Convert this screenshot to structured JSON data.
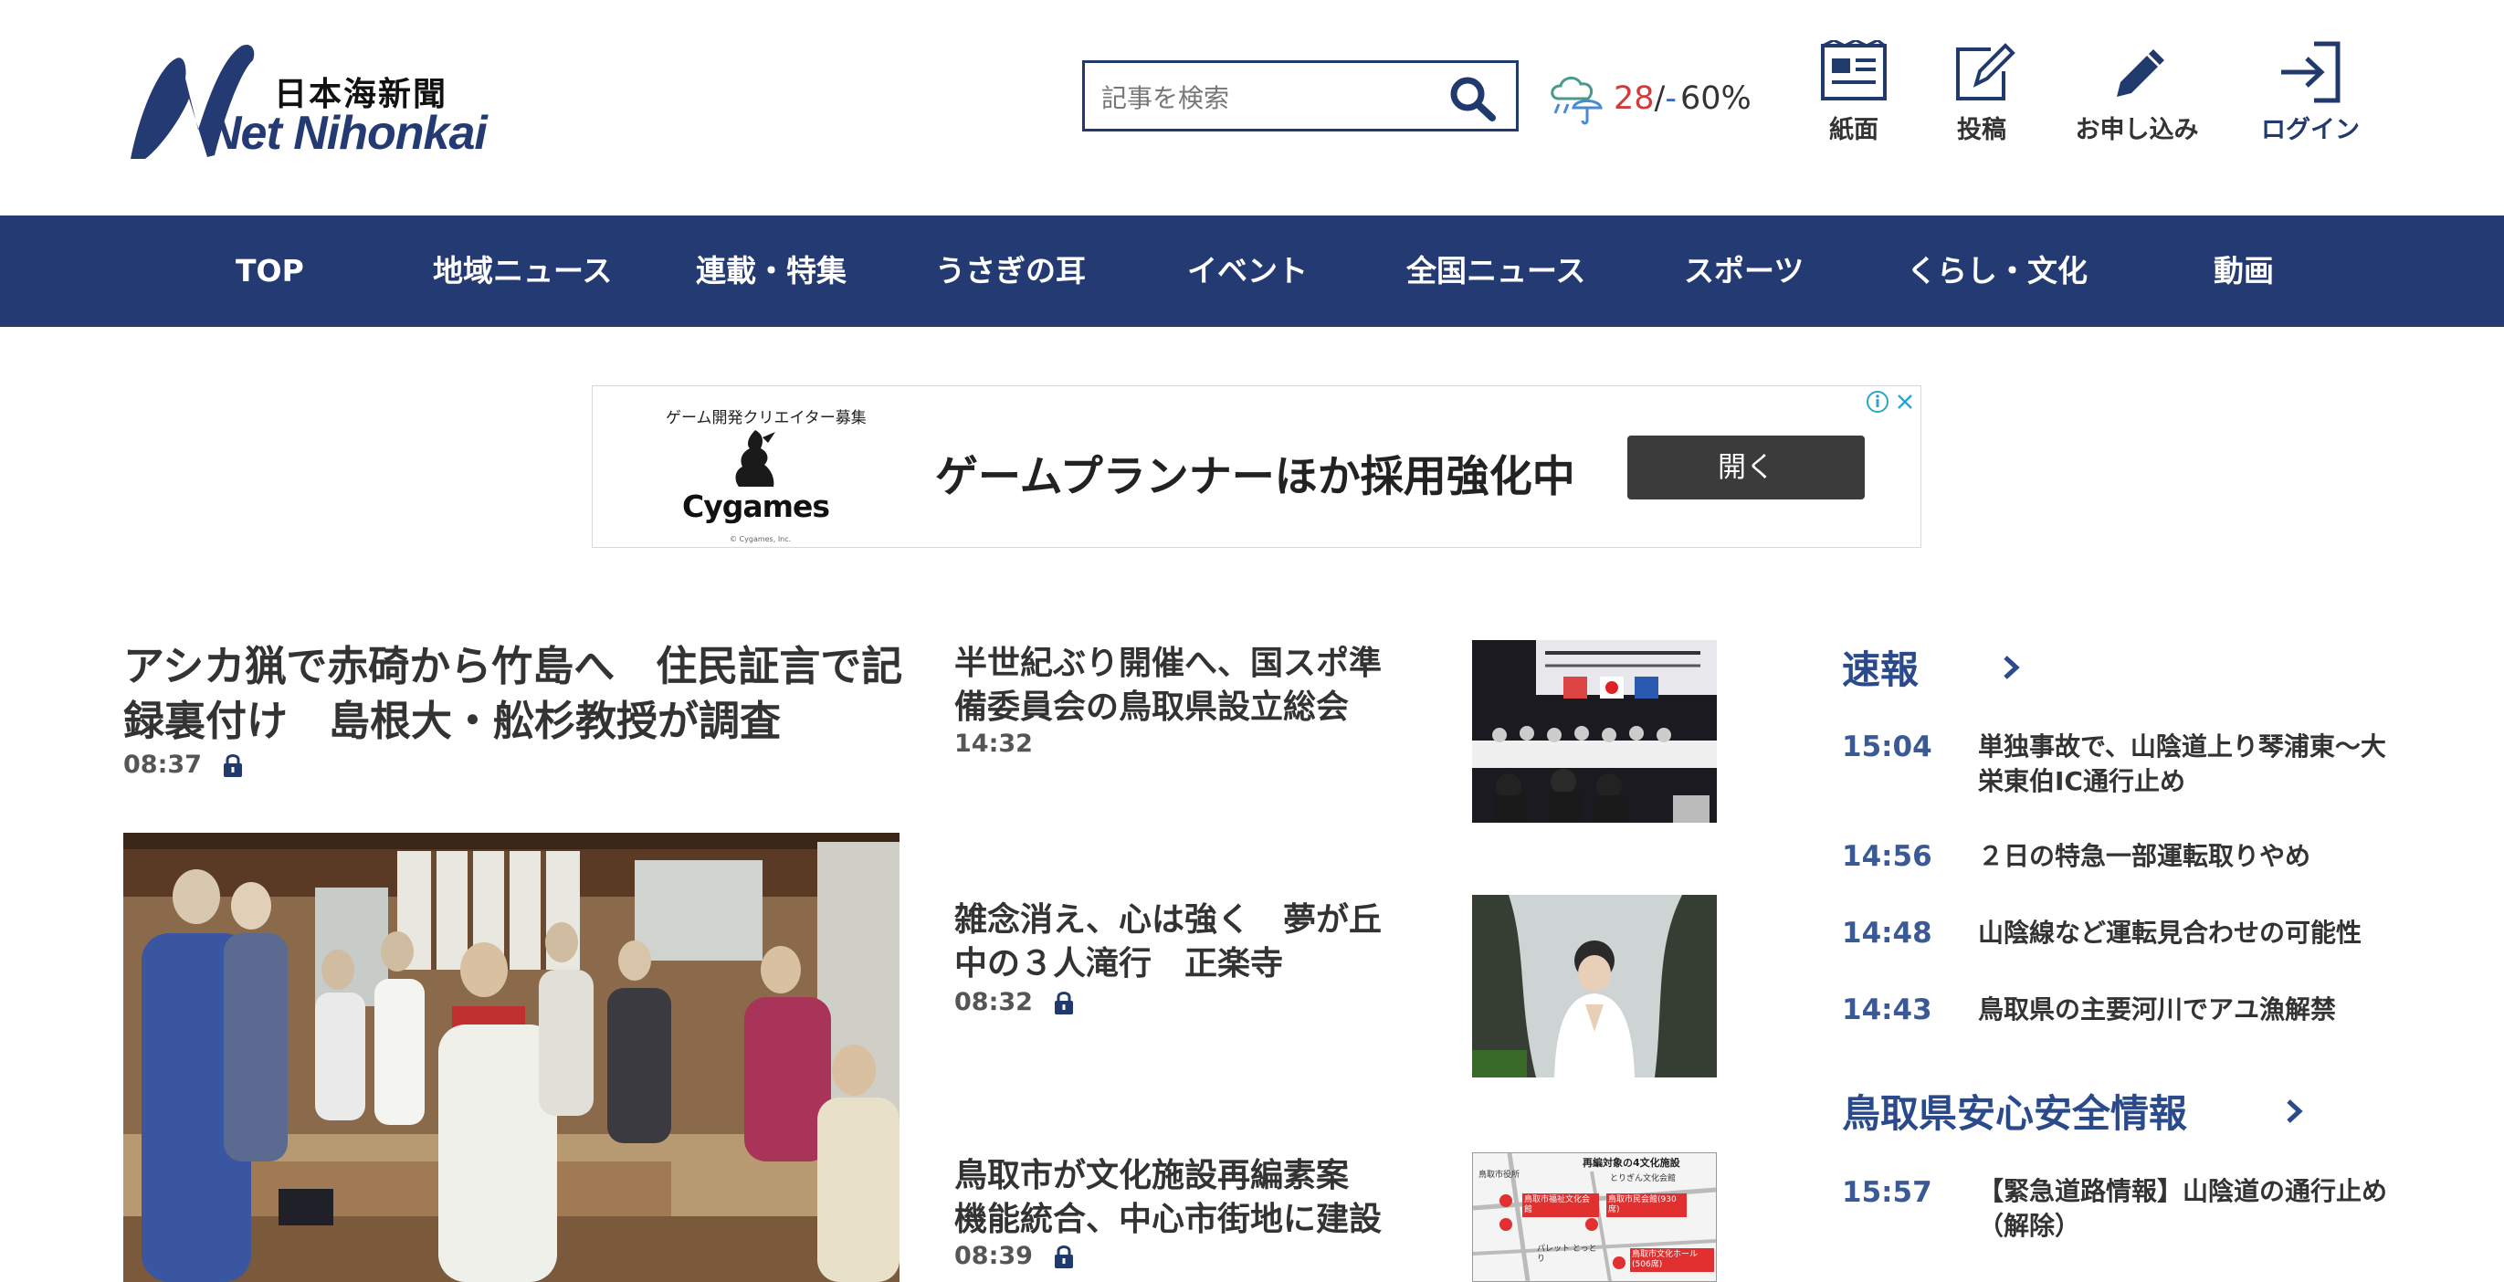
{
  "header": {
    "logo_kanji": "日本海新聞",
    "logo_text": "Net Nihonkai",
    "search": {
      "placeholder": "記事を検索"
    },
    "weather": {
      "temp": "28",
      "slash": "/",
      "dash": "-",
      "rain": "60%"
    },
    "links": [
      {
        "label": "紙面",
        "icon": "newspaper-icon"
      },
      {
        "label": "投稿",
        "icon": "edit-icon"
      },
      {
        "label": "お申し込み",
        "icon": "pen-icon"
      },
      {
        "label": "ログイン",
        "icon": "login-icon"
      }
    ]
  },
  "nav": {
    "items": [
      "TOP",
      "地域ニュース",
      "連載・特集",
      "うさぎの耳",
      "イベント",
      "全国ニュース",
      "スポーツ",
      "くらし・文化",
      "動画"
    ]
  },
  "ad": {
    "small_text": "ゲーム開発クリエイター募集",
    "brand": "Cygames",
    "copyright": "© Cygames, Inc.",
    "headline": "ゲームプランナーほか採用強化中",
    "button": "開く"
  },
  "main_article": {
    "title": "アシカ猟で赤碕から竹島へ　住民証言で記録裏付け　島根大・舩杉教授が調査",
    "time": "08:37"
  },
  "mid_articles": [
    {
      "title": "半世紀ぶり開催へ、国スポ準備委員会の鳥取県設立総会",
      "time": "14:32",
      "locked": false
    },
    {
      "title": "雑念消え、心は強く　夢が丘中の３人滝行　正楽寺",
      "time": "08:32",
      "locked": true
    },
    {
      "title": "鳥取市が文化施設再編素案　機能統合、中心市街地に建設",
      "time": "08:39",
      "locked": true
    }
  ],
  "thumb_map": {
    "header": "再編対象の4文化施設",
    "labels": [
      "鳥取市福祉文化会館",
      "鳥取市民会館(930席)",
      "鳥取市文化ホール(506席)",
      "パレット とっとり",
      "鳥取市役所",
      "とりぎん文化会館"
    ]
  },
  "breaking": {
    "title": "速報",
    "items": [
      {
        "time": "15:04",
        "text": "単独事故で、山陰道上り琴浦東～大栄東伯IC通行止め"
      },
      {
        "time": "14:56",
        "text": "２日の特急一部運転取りやめ"
      },
      {
        "time": "14:48",
        "text": "山陰線など運転見合わせの可能性"
      },
      {
        "time": "14:43",
        "text": "鳥取県の主要河川でアユ漁解禁"
      }
    ]
  },
  "safety": {
    "title": "鳥取県安心安全情報",
    "items": [
      {
        "time": "15:57",
        "text": "【緊急道路情報】山陰道の通行止め（解除）"
      }
    ]
  },
  "colors": {
    "brand": "#243a72",
    "accent": "#2a4a8c",
    "temp": "#d23b3b"
  }
}
